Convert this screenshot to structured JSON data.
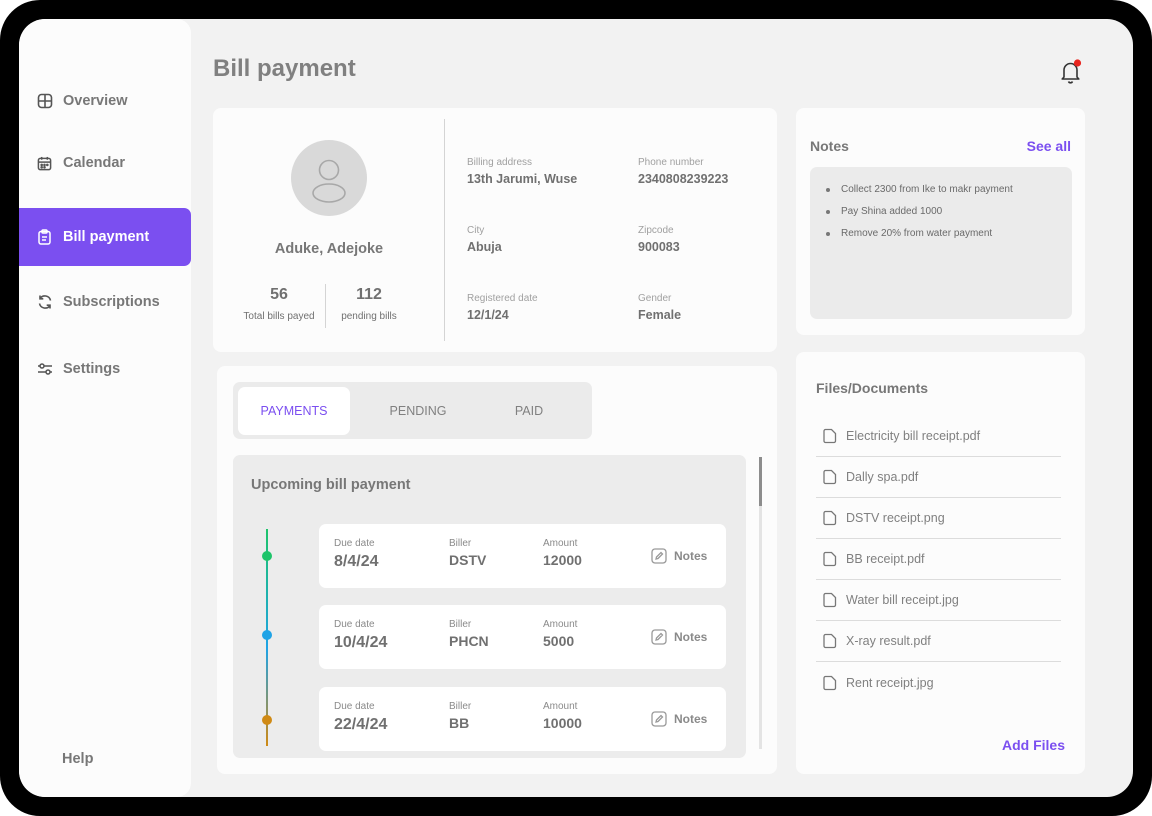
{
  "sidebar": {
    "items": [
      {
        "label": "Overview",
        "icon": "grid-icon"
      },
      {
        "label": "Calendar",
        "icon": "calendar-icon"
      },
      {
        "label": "Bill payment",
        "icon": "clipboard-icon"
      },
      {
        "label": "Subscriptions",
        "icon": "refresh-icon"
      },
      {
        "label": "Settings",
        "icon": "sliders-icon"
      }
    ],
    "active": "Bill payment",
    "help_label": "Help"
  },
  "header": {
    "title": "Bill payment",
    "notification_icon": "bell-icon"
  },
  "colors": {
    "accent": "#7b4ff0",
    "notification": "#e8251f",
    "dot_green": "#1ec46a",
    "dot_blue": "#1fa3e6",
    "dot_orange": "#d08a14"
  },
  "profile": {
    "name": "Aduke, Adejoke",
    "stats": [
      {
        "value": "56",
        "label": "Total bills payed"
      },
      {
        "value": "112",
        "label": "pending bills"
      }
    ],
    "fields": [
      {
        "label": "Billing address",
        "value": "13th Jarumi, Wuse"
      },
      {
        "label": "Phone number",
        "value": "2340808239223"
      },
      {
        "label": "City",
        "value": "Abuja"
      },
      {
        "label": "Zipcode",
        "value": "900083"
      },
      {
        "label": "Registered date",
        "value": "12/1/24"
      },
      {
        "label": "Gender",
        "value": "Female"
      }
    ]
  },
  "tabs": [
    {
      "label": "PAYMENTS",
      "active": true
    },
    {
      "label": "PENDING",
      "active": false
    },
    {
      "label": "PAID",
      "active": false
    }
  ],
  "upcoming": {
    "title": "Upcoming bill payment",
    "col_labels": {
      "due": "Due date",
      "biller": "Biller",
      "amount": "Amount"
    },
    "notes_label": "Notes",
    "bills": [
      {
        "due": "8/4/24",
        "biller": "DSTV",
        "amount": "12000"
      },
      {
        "due": "10/4/24",
        "biller": "PHCN",
        "amount": "5000"
      },
      {
        "due": "22/4/24",
        "biller": "BB",
        "amount": "10000"
      }
    ]
  },
  "notes": {
    "title": "Notes",
    "see_all": "See all",
    "items": [
      "Collect 2300 from Ike to makr payment",
      "Pay Shina added 1000",
      "Remove 20% from water payment"
    ]
  },
  "files": {
    "title": "Files/Documents",
    "items": [
      "Electricity bill receipt.pdf",
      "Dally spa.pdf",
      "DSTV receipt.png",
      "BB receipt.pdf",
      "Water bill receipt.jpg",
      "X-ray result.pdf",
      "Rent receipt.jpg"
    ],
    "add_label": "Add Files"
  }
}
